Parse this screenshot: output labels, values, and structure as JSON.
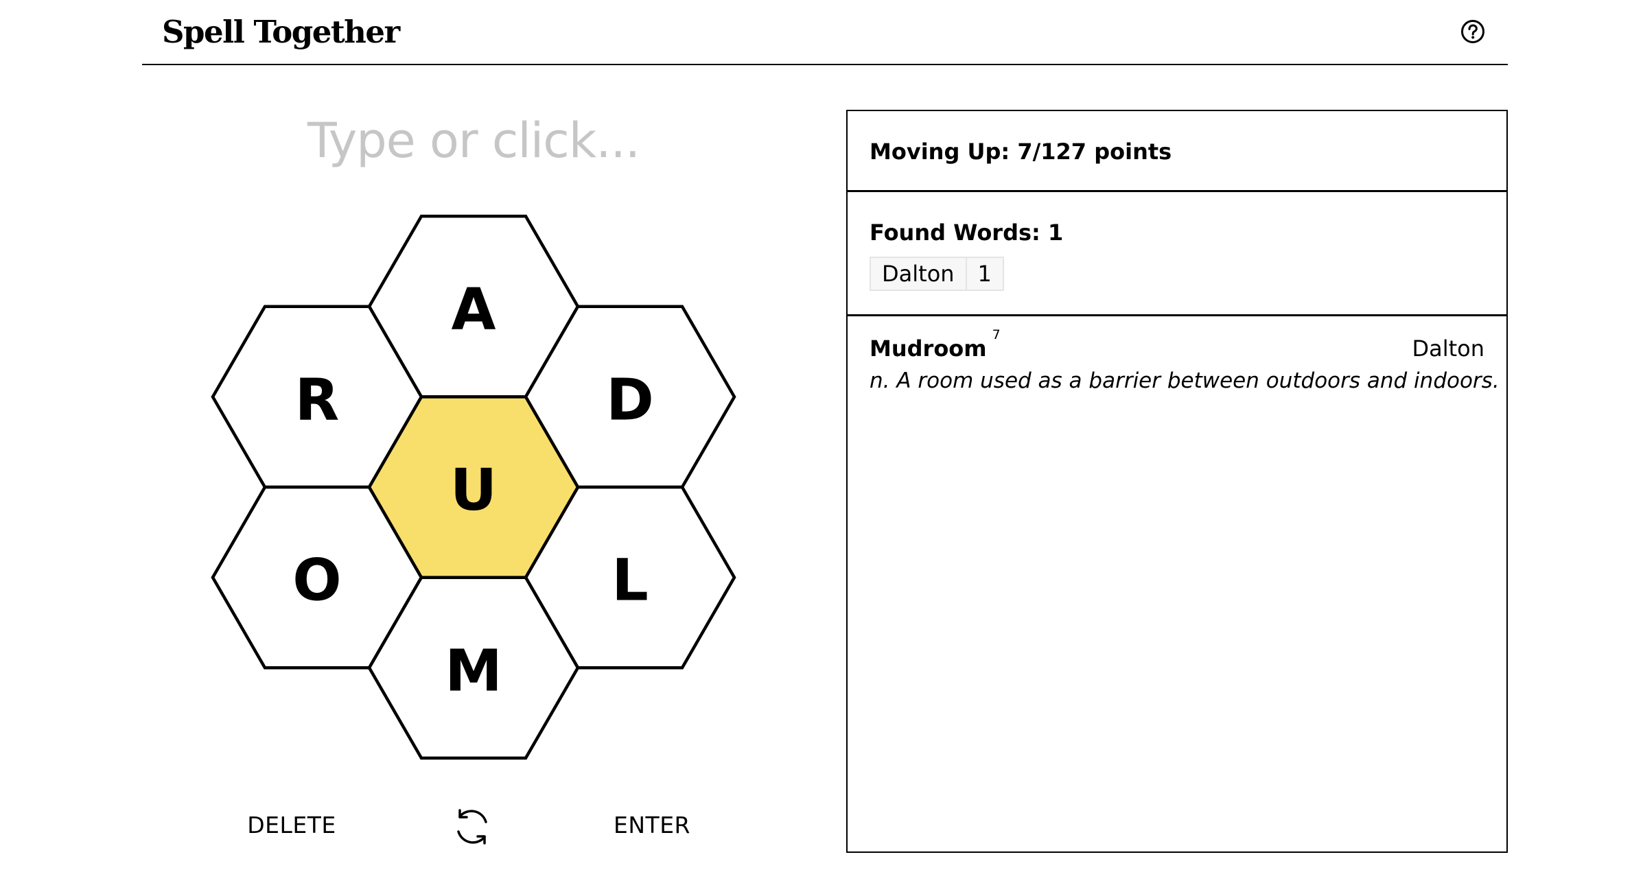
{
  "header": {
    "title": "Spell Together",
    "help_icon": "question-circle-icon"
  },
  "input": {
    "placeholder": "Type or click..."
  },
  "hive": {
    "center_letter": "U",
    "center_color": "#f8df6b",
    "outer_letters": {
      "top": "A",
      "upper_left": "R",
      "upper_right": "D",
      "lower_left": "O",
      "lower_right": "L",
      "bottom": "M"
    }
  },
  "controls": {
    "delete_label": "DELETE",
    "shuffle_icon": "shuffle-arrows-icon",
    "enter_label": "ENTER"
  },
  "progress": {
    "text": "Moving Up: 7/127 points"
  },
  "found": {
    "title": "Found Words: 1",
    "players": [
      {
        "name": "Dalton",
        "count": "1"
      }
    ]
  },
  "words": [
    {
      "word": "Mudroom",
      "points": "7",
      "finder": "Dalton",
      "definition": "n. A room used as a barrier between outdoors and indoors."
    }
  ]
}
